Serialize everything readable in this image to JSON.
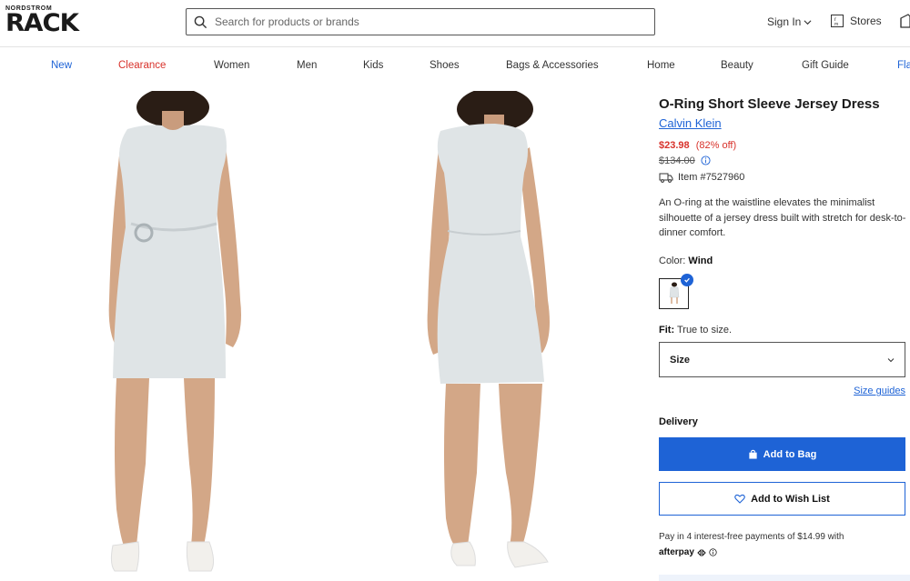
{
  "header": {
    "logo_top": "NORDSTROM",
    "logo_main": "RACK",
    "search_placeholder": "Search for products or brands",
    "signin_label": "Sign In",
    "stores_label": "Stores"
  },
  "nav": {
    "items": [
      {
        "label": "New",
        "color": "#1e63d6"
      },
      {
        "label": "Clearance",
        "color": "#d8322b"
      },
      {
        "label": "Women",
        "color": "#333333"
      },
      {
        "label": "Men",
        "color": "#333333"
      },
      {
        "label": "Kids",
        "color": "#333333"
      },
      {
        "label": "Shoes",
        "color": "#333333"
      },
      {
        "label": "Bags & Accessories",
        "color": "#333333"
      },
      {
        "label": "Home",
        "color": "#333333"
      },
      {
        "label": "Beauty",
        "color": "#333333"
      },
      {
        "label": "Gift Guide",
        "color": "#333333"
      },
      {
        "label": "Fla",
        "color": "#1e63d6"
      }
    ]
  },
  "product": {
    "title": "O-Ring Short Sleeve Jersey Dress",
    "brand": "Calvin Klein",
    "sale_price": "$23.98",
    "discount": "(82% off)",
    "original_price": "$134.00",
    "item_number": "Item #7527960",
    "description": "An O-ring at the waistline elevates the minimalist silhouette of a jersey dress built with stretch for desk-to-dinner comfort.",
    "color_label": "Color:",
    "color_value": "Wind",
    "fit_label": "Fit:",
    "fit_value": "True to size.",
    "size_label": "Size",
    "size_guides": "Size guides",
    "delivery_label": "Delivery",
    "add_to_bag": "Add to Bag",
    "add_to_wishlist": "Add to Wish List",
    "pay_text": "Pay in 4 interest-free payments of $14.99 with",
    "afterpay": "afterpay"
  },
  "colors": {
    "accent": "#1e63d6",
    "sale": "#d8322b",
    "dress": "#dfe4e6"
  }
}
